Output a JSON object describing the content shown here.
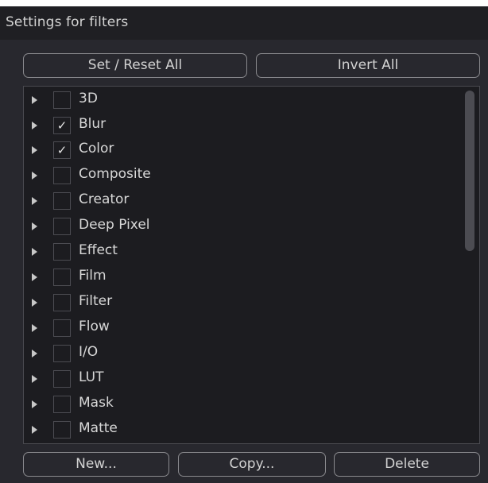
{
  "window": {
    "title": "Settings for filters"
  },
  "actions": {
    "set_reset_all": "Set / Reset All",
    "invert_all": "Invert All"
  },
  "filters": [
    {
      "label": "3D",
      "checked": false
    },
    {
      "label": "Blur",
      "checked": true
    },
    {
      "label": "Color",
      "checked": true
    },
    {
      "label": "Composite",
      "checked": false
    },
    {
      "label": "Creator",
      "checked": false
    },
    {
      "label": "Deep Pixel",
      "checked": false
    },
    {
      "label": "Effect",
      "checked": false
    },
    {
      "label": "Film",
      "checked": false
    },
    {
      "label": "Filter",
      "checked": false
    },
    {
      "label": "Flow",
      "checked": false
    },
    {
      "label": "I/O",
      "checked": false
    },
    {
      "label": "LUT",
      "checked": false
    },
    {
      "label": "Mask",
      "checked": false
    },
    {
      "label": "Matte",
      "checked": false
    }
  ],
  "check_glyph": "✓",
  "footer": {
    "new_label": "New...",
    "copy_label": "Copy...",
    "delete_label": "Delete"
  },
  "colors": {
    "panel_bg": "#28282e",
    "header_bg": "#1f1f23",
    "list_bg": "#1c1c20",
    "button_border": "#8a8a8e",
    "text": "#d2d2d2"
  },
  "icons": {
    "expand": "chevron-right-icon",
    "check": "checkmark-icon"
  }
}
